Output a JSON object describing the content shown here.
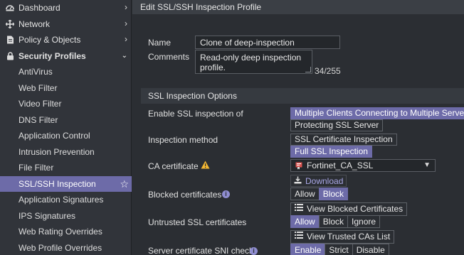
{
  "sidebar": {
    "items": [
      {
        "label": "Dashboard",
        "icon": "dashboard-icon"
      },
      {
        "label": "Network",
        "icon": "network-icon"
      },
      {
        "label": "Policy & Objects",
        "icon": "policy-icon"
      },
      {
        "label": "Security Profiles",
        "icon": "lock-icon"
      }
    ],
    "subitems": [
      "AntiVirus",
      "Web Filter",
      "Video Filter",
      "DNS Filter",
      "Application Control",
      "Intrusion Prevention",
      "File Filter",
      "SSL/SSH Inspection",
      "Application Signatures",
      "IPS Signatures",
      "Web Rating Overrides",
      "Web Profile Overrides"
    ]
  },
  "page": {
    "title": "Edit SSL/SSH Inspection Profile",
    "name_label": "Name",
    "name_value": "Clone of deep-inspection",
    "comments_label": "Comments",
    "comments_value_line1": "Read-only deep inspection",
    "comments_value_line2": "profile.",
    "comments_counter": "34/255",
    "section_title": "SSL Inspection Options",
    "enable_label": "Enable SSL inspection of",
    "enable_options": [
      "Multiple Clients Connecting to Multiple Servers",
      "Protecting SSL Server"
    ],
    "method_label": "Inspection method",
    "method_options": [
      "SSL Certificate Inspection",
      "Full SSL Inspection"
    ],
    "ca_label": "CA certificate",
    "ca_value": "Fortinet_CA_SSL",
    "download_label": "Download",
    "blocked_label": "Blocked certificates",
    "blocked_options": [
      "Allow",
      "Block"
    ],
    "view_blocked_label": "View Blocked Certificates",
    "untrusted_label": "Untrusted SSL certificates",
    "untrusted_options": [
      "Allow",
      "Block",
      "Ignore"
    ],
    "view_trusted_label": "View Trusted CAs List",
    "sni_label": "Server certificate SNI check",
    "sni_options": [
      "Enable",
      "Strict",
      "Disable"
    ]
  },
  "colors": {
    "accent": "#6d6ba8",
    "warning": "#f2b632"
  }
}
